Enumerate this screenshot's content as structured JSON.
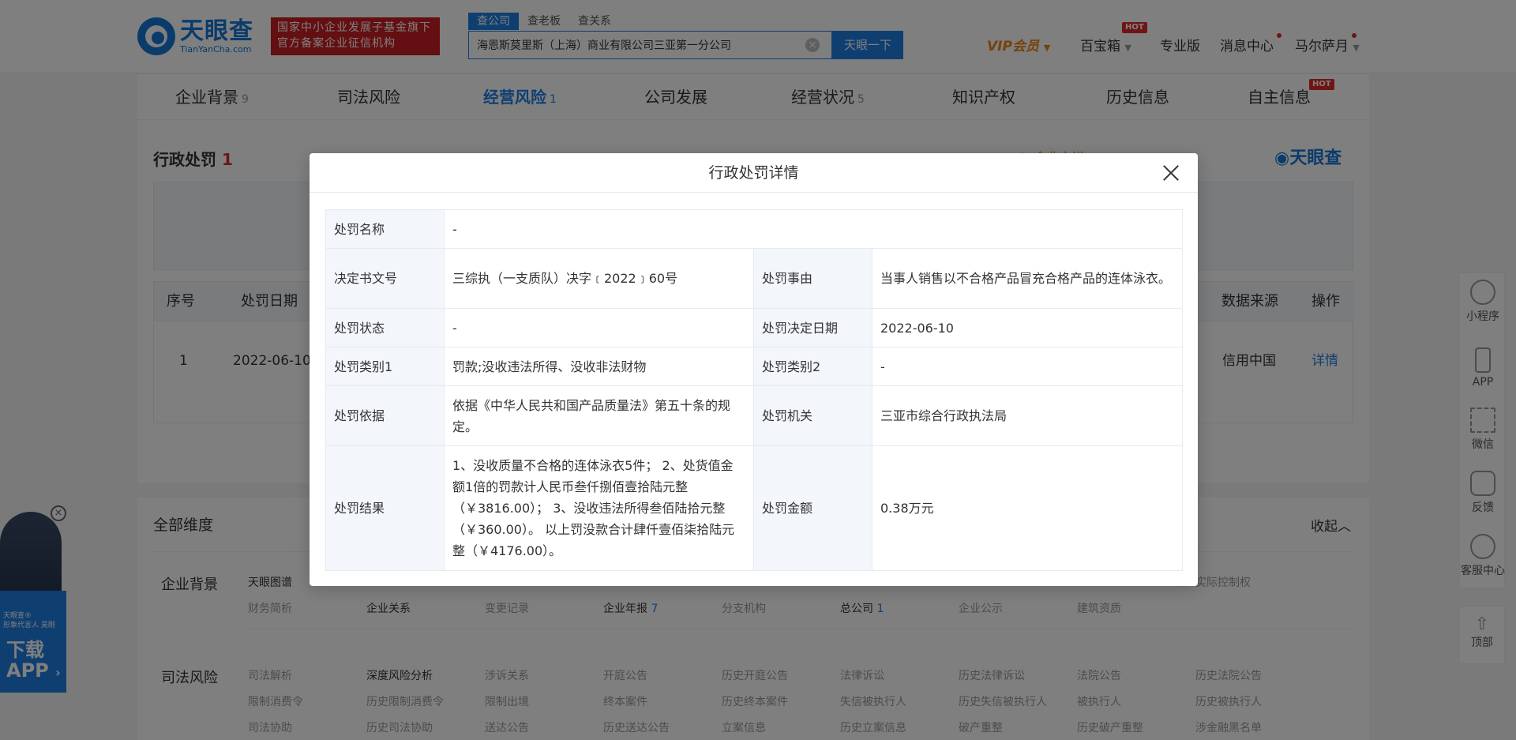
{
  "header": {
    "logo_cn": "天眼查",
    "logo_en": "TianYanCha.com",
    "banner_line1": "国家中小企业发展子基金旗下",
    "banner_line2": "官方备案企业征信机构",
    "search_tabs": [
      "查公司",
      "查老板",
      "查关系"
    ],
    "search_value": "海恩斯莫里斯（上海）商业有限公司三亚第一分公司",
    "search_button": "天眼一下",
    "vip": "VIP会员",
    "toolbox": "百宝箱",
    "hot": "HOT",
    "pro": "专业版",
    "messages": "消息中心",
    "user": "马尔萨月"
  },
  "tabs": [
    {
      "label": "企业背景",
      "count": "9"
    },
    {
      "label": "司法风险",
      "count": ""
    },
    {
      "label": "经营风险",
      "count": "1"
    },
    {
      "label": "公司发展",
      "count": ""
    },
    {
      "label": "经营状况",
      "count": "5"
    },
    {
      "label": "知识产权",
      "count": ""
    },
    {
      "label": "历史信息",
      "count": ""
    },
    {
      "label": "自主信息",
      "count": ""
    }
  ],
  "section": {
    "title": "行政处罚",
    "count": "1",
    "company_says": "企业主说",
    "brand": "天眼查",
    "columns": [
      "序号",
      "处罚日期",
      "数据来源",
      "操作"
    ],
    "row": {
      "index": "1",
      "date": "2022-06-10",
      "source": "信用中国",
      "action": "详情"
    }
  },
  "dimensions": {
    "title": "全部维度",
    "collapse": "收起",
    "bg_title": "企业背景",
    "bg_row1": [
      {
        "label": "天眼图谱",
        "count": "",
        "active": true
      },
      {
        "label": "实际控制权",
        "count": "",
        "active": false
      }
    ],
    "bg_row2": [
      {
        "label": "财务简析",
        "count": "",
        "active": false
      },
      {
        "label": "企业关系",
        "count": "",
        "active": true
      },
      {
        "label": "变更记录",
        "count": "",
        "active": false
      },
      {
        "label": "企业年报",
        "count": "7",
        "active": true
      },
      {
        "label": "分支机构",
        "count": "",
        "active": false
      },
      {
        "label": "总公司",
        "count": "1",
        "active": true
      },
      {
        "label": "企业公示",
        "count": "",
        "active": false
      },
      {
        "label": "建筑资质",
        "count": "",
        "active": false
      }
    ],
    "judicial_title": "司法风险",
    "jud_row1": [
      "司法解析",
      "深度风险分析",
      "涉诉关系",
      "开庭公告",
      "历史开庭公告",
      "法律诉讼",
      "历史法律诉讼",
      "法院公告",
      "历史法院公告"
    ],
    "jud_row2": [
      "限制消费令",
      "历史限制消费令",
      "限制出境",
      "终本案件",
      "历史终本案件",
      "失信被执行人",
      "历史失信被执行人",
      "被执行人",
      "历史被执行人"
    ],
    "jud_row3": [
      "司法协助",
      "历史司法协助",
      "送达公告",
      "历史送达公告",
      "立案信息",
      "历史立案信息",
      "破产重整",
      "历史破产重整",
      "涉金融黑名单"
    ]
  },
  "sidebar": {
    "items": [
      "小程序",
      "APP",
      "微信",
      "反馈",
      "客服中心"
    ],
    "top": "顶部"
  },
  "ad": {
    "small1": "天眼查®",
    "small2": "形象代言人 吴刚",
    "big1": "下载",
    "big2": "APP"
  },
  "modal": {
    "title": "行政处罚详情",
    "fields": {
      "name_label": "处罚名称",
      "name_value": "-",
      "doc_label": "决定书文号",
      "doc_value": "三综执（一支质队）决字﹝2022﹞60号",
      "reason_label": "处罚事由",
      "reason_value": "当事人销售以不合格产品冒充合格产品的连体泳衣。",
      "status_label": "处罚状态",
      "status_value": "-",
      "date_label": "处罚决定日期",
      "date_value": "2022-06-10",
      "type1_label": "处罚类别1",
      "type1_value": "罚款;没收违法所得、没收非法财物",
      "type2_label": "处罚类别2",
      "type2_value": "-",
      "basis_label": "处罚依据",
      "basis_value": "依据《中华人民共和国产品质量法》第五十条的规定。",
      "authority_label": "处罚机关",
      "authority_value": "三亚市综合行政执法局",
      "result_label": "处罚结果",
      "result_value": "1、没收质量不合格的连体泳衣5件； 2、处货值金额1倍的罚款计人民币叁仟捌佰壹拾陆元整（￥3816.00）； 3、没收违法所得叁佰陆拾元整（￥360.00）。 以上罚没款合计肆仟壹佰柒拾陆元整（￥4176.00）。",
      "amount_label": "处罚金额",
      "amount_value": "0.38万元"
    }
  }
}
